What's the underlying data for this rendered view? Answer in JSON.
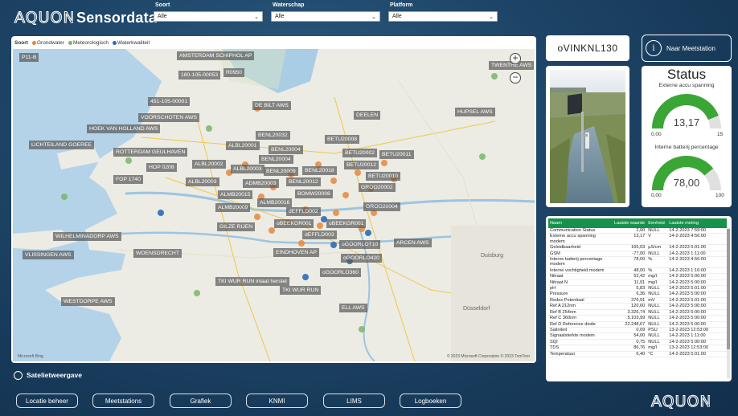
{
  "header": {
    "brand": "AQUON",
    "title": "Sensordata",
    "filters": [
      {
        "label": "Soort",
        "value": "Alle"
      },
      {
        "label": "Waterschap",
        "value": "Alle"
      },
      {
        "label": "Platform",
        "value": "Alle"
      }
    ]
  },
  "legend": {
    "title": "Soort",
    "items": [
      {
        "label": "Grondwater",
        "color": "#e8883a"
      },
      {
        "label": "Meteorologisch",
        "color": "#7ab56a"
      },
      {
        "label": "Waterkwaliteit",
        "color": "#2a6db5"
      }
    ]
  },
  "map": {
    "labels": [
      "P11-B",
      "AMSTERDAM SCHIPHOL AP",
      "180-105-00053",
      "R0950",
      "TWENTHE AWS",
      "451-105-00001",
      "DE BILT AWS",
      "VOORSCHOTEN AWS",
      "DEELEN",
      "HUPSEL AWS",
      "HOEK VAN HOLLAND AWS",
      "BENL20032",
      "LICHTEILAND GOEREE",
      "ALBL20001",
      "BENL20004",
      "BETU20008",
      "ROTTERDAM GEULHAVEN",
      "BENL20004",
      "BETU20002",
      "BETU20011",
      "ALBL20002",
      "HOP 0208",
      "ALBL20003",
      "BENL20009",
      "BENL20018",
      "BETU20012",
      "BETU20010",
      "FOP 1740",
      "ALBL20003",
      "BENL20012",
      "ADMB20003",
      "ALMB20015",
      "BOMW20006",
      "GROO20002",
      "ALMB20016",
      "ALMB20009",
      "GROO20004",
      "dEFFLD002",
      "oBEEKGR001",
      "oBEEKGR001",
      "GILZE RIJEN",
      "dEFFLD003",
      "WILHELMINADORP AWS",
      "oGOORLOT10",
      "ARCEN AWS",
      "VLISSINGEN AWS",
      "WOENSDRECHT",
      "EINDHOVEN AP",
      "oGOORLO420",
      "oGOORLO360",
      "TKI WUR RUN inlaat herstel",
      "TKI WUR RUN",
      "WESTDORPE AWS",
      "ELL AWS"
    ],
    "cities": [
      "Duisburg",
      "Düsseldorf"
    ],
    "zoom_in": "+",
    "zoom_out": "−",
    "attribution_left": "Microsoft Bing",
    "attribution_right": "© 2023 Microsoft Corporation  © 2023 TomTom"
  },
  "satellite": {
    "label": "Satelietweergave"
  },
  "station": {
    "name": "oVINKNL130",
    "nav_button": "Naar Meetstation",
    "info_icon": "i"
  },
  "status": {
    "title": "Status",
    "gauges": [
      {
        "title": "Externe accu spanning",
        "value": "13,17",
        "min": "0,00",
        "max": "15",
        "fraction": 0.878,
        "color": "#3aa635"
      },
      {
        "title": "Interne batterij percentage",
        "value": "78,00",
        "min": "0,00",
        "max": "100",
        "fraction": 0.78,
        "color": "#3aa635"
      }
    ]
  },
  "table": {
    "headers": [
      "Naam",
      "Laatste waarde",
      "Eenheid",
      "Laatste meting"
    ],
    "rows": [
      [
        "Communication Status",
        "2,00",
        "NULL",
        "14-2-2023 7:59:00"
      ],
      [
        "Externe accu spanning modem",
        "13,17",
        "V",
        "14-2-2023 4:56:00"
      ],
      [
        "Geleidbaarheid",
        "165,03",
        "µS/cm",
        "14-2-2023 5:01:00"
      ],
      [
        "GSM",
        "-77,00",
        "NULL",
        "14-2-2023 1:11:00"
      ],
      [
        "Interne batterij percentage modem",
        "78,00",
        "%",
        "14-2-2023 4:56:00"
      ],
      [
        "Interne vochtigheid modem",
        "48,00",
        "%",
        "14-2-2023 1:16:00"
      ],
      [
        "Nitraat",
        "52,42",
        "mg/l",
        "14-2-2023 5:00:00"
      ],
      [
        "Nitraat N",
        "11,91",
        "mg/l",
        "14-2-2023 5:00:00"
      ],
      [
        "pH",
        "5,83",
        "NULL",
        "14-2-2023 5:01:00"
      ],
      [
        "Pressure",
        "6,36",
        "NULL",
        "14-2-2023 5:00:00"
      ],
      [
        "Redox Potentiaal",
        "376,91",
        "mV",
        "14-2-2023 5:01:00"
      ],
      [
        "Ref A 212nm",
        "120,60",
        "NULL",
        "14-2-2023 5:00:00"
      ],
      [
        "Ref B 254nm",
        "3.326,74",
        "NULL",
        "14-2-2023 5:00:00"
      ],
      [
        "Ref C 360nm",
        "5.103,99",
        "NULL",
        "14-2-2023 5:00:00"
      ],
      [
        "Ref D Reference diode",
        "22.248,67",
        "NULL",
        "14-2-2023 5:00:00"
      ],
      [
        "Saliniteit",
        "0,09",
        "PSU",
        "13-2-2023 12:53:00"
      ],
      [
        "Signaalsterkte modem",
        "54,00",
        "NULL",
        "14-2-2023 1:11:00"
      ],
      [
        "SQI",
        "0,75",
        "NULL",
        "14-2-2023 5:00:00"
      ],
      [
        "TDS",
        "86,76",
        "mg/l",
        "13-2-2023 12:53:00"
      ],
      [
        "Temperatuur",
        "6,40",
        "°C",
        "14-2-2023 5:01:00"
      ]
    ]
  },
  "nav": [
    "Locatie beheer",
    "Meetstations",
    "Grafiek",
    "KNMI",
    "LIMS",
    "Logboeken"
  ],
  "colors": {
    "accent": "#17924a",
    "background": "#1d4466"
  }
}
